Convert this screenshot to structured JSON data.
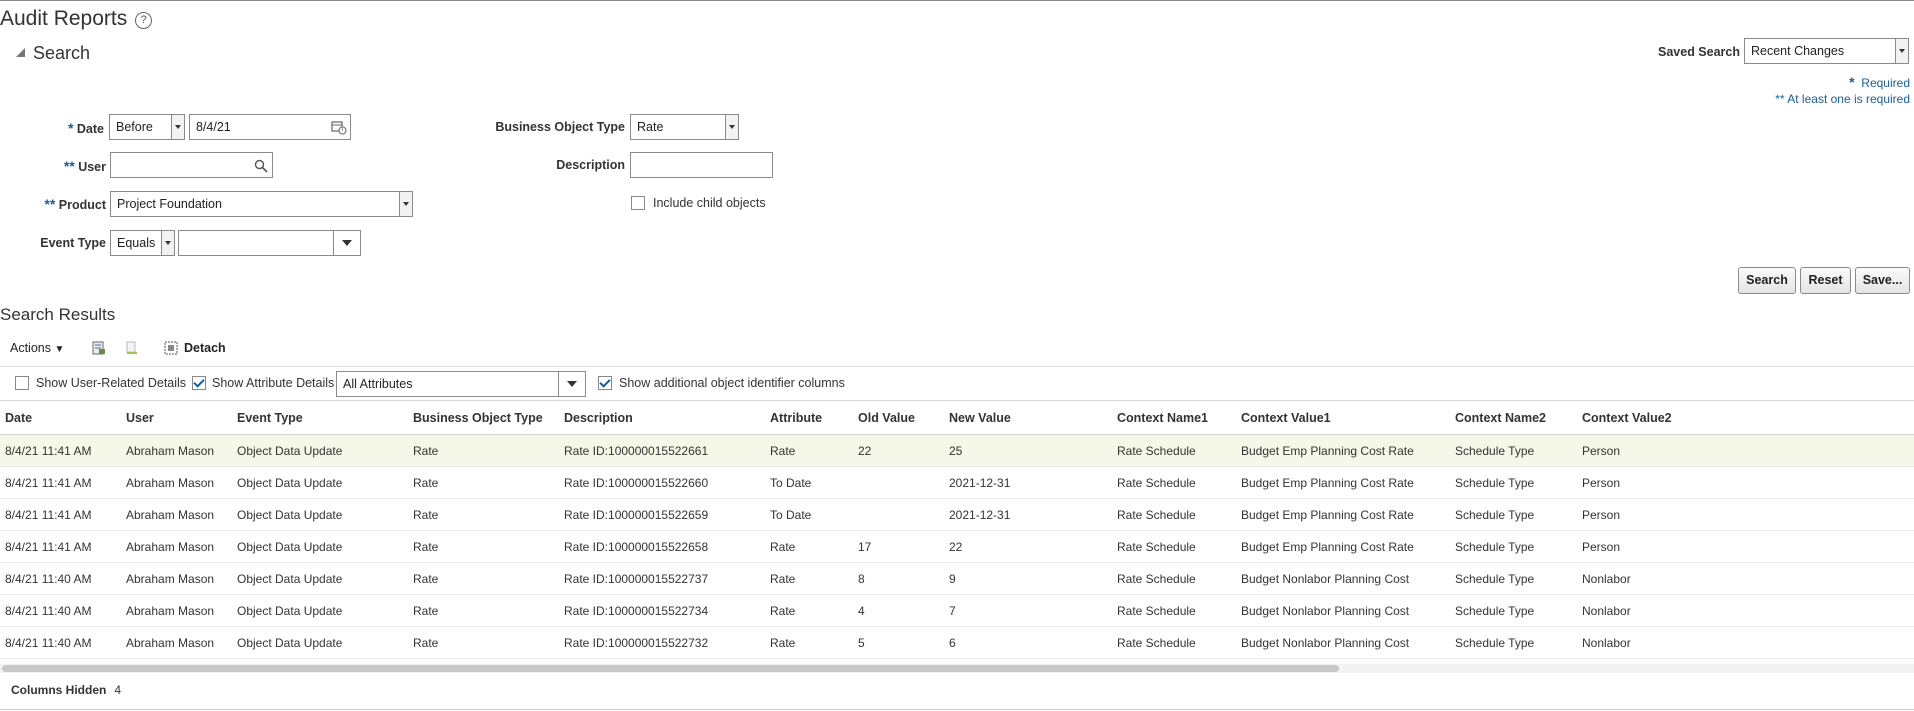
{
  "page": {
    "title": "Audit Reports",
    "help_glyph": "?"
  },
  "search": {
    "toggle_label": "Search",
    "saved_search_label": "Saved Search",
    "saved_search_value": "Recent Changes",
    "required_note": "Required",
    "at_least_one_note": "** At least one is required",
    "star": "*",
    "double_star": "**",
    "date_label": "Date",
    "date_operator": "Before",
    "date_value": "8/4/21",
    "user_label": "User",
    "user_value": "",
    "product_label": "Product",
    "product_value": "Project Foundation",
    "event_type_label": "Event Type",
    "event_type_operator": "Equals",
    "event_type_value": "",
    "bo_type_label": "Business Object Type",
    "bo_type_value": "Rate",
    "description_label": "Description",
    "description_value": "",
    "include_child_label": "Include child objects"
  },
  "buttons": {
    "search": "Search",
    "reset": "Reset",
    "save": "Save..."
  },
  "results": {
    "title": "Search Results",
    "actions_label": "Actions",
    "detach_label": "Detach",
    "show_user_details": "Show User-Related Details",
    "show_attr_details": "Show Attribute Details",
    "attributes_select": "All Attributes",
    "show_additional": "Show additional object identifier columns",
    "columns": [
      "Date",
      "User",
      "Event Type",
      "Business Object Type",
      "Description",
      "Attribute",
      "Old Value",
      "New Value",
      "Context Name1",
      "Context Value1",
      "Context Name2",
      "Context Value2"
    ],
    "rows": [
      [
        "8/4/21 11:41 AM",
        "Abraham Mason",
        "Object Data Update",
        "Rate",
        "Rate ID:100000015522661",
        "Rate",
        "22",
        "25",
        "Rate Schedule",
        "Budget Emp Planning Cost Rate",
        "Schedule Type",
        "Person"
      ],
      [
        "8/4/21 11:41 AM",
        "Abraham Mason",
        "Object Data Update",
        "Rate",
        "Rate ID:100000015522660",
        "To Date",
        "",
        "2021-12-31",
        "Rate Schedule",
        "Budget Emp Planning Cost Rate",
        "Schedule Type",
        "Person"
      ],
      [
        "8/4/21 11:41 AM",
        "Abraham Mason",
        "Object Data Update",
        "Rate",
        "Rate ID:100000015522659",
        "To Date",
        "",
        "2021-12-31",
        "Rate Schedule",
        "Budget Emp Planning Cost Rate",
        "Schedule Type",
        "Person"
      ],
      [
        "8/4/21 11:41 AM",
        "Abraham Mason",
        "Object Data Update",
        "Rate",
        "Rate ID:100000015522658",
        "Rate",
        "17",
        "22",
        "Rate Schedule",
        "Budget Emp Planning Cost Rate",
        "Schedule Type",
        "Person"
      ],
      [
        "8/4/21 11:40 AM",
        "Abraham Mason",
        "Object Data Update",
        "Rate",
        "Rate ID:100000015522737",
        "Rate",
        "8",
        "9",
        "Rate Schedule",
        "Budget Nonlabor Planning Cost",
        "Schedule Type",
        "Nonlabor"
      ],
      [
        "8/4/21 11:40 AM",
        "Abraham Mason",
        "Object Data Update",
        "Rate",
        "Rate ID:100000015522734",
        "Rate",
        "4",
        "7",
        "Rate Schedule",
        "Budget Nonlabor Planning Cost",
        "Schedule Type",
        "Nonlabor"
      ],
      [
        "8/4/21 11:40 AM",
        "Abraham Mason",
        "Object Data Update",
        "Rate",
        "Rate ID:100000015522732",
        "Rate",
        "5",
        "6",
        "Rate Schedule",
        "Budget Nonlabor Planning Cost",
        "Schedule Type",
        "Nonlabor"
      ]
    ],
    "columns_hidden_label": "Columns Hidden",
    "columns_hidden_count": "4"
  }
}
